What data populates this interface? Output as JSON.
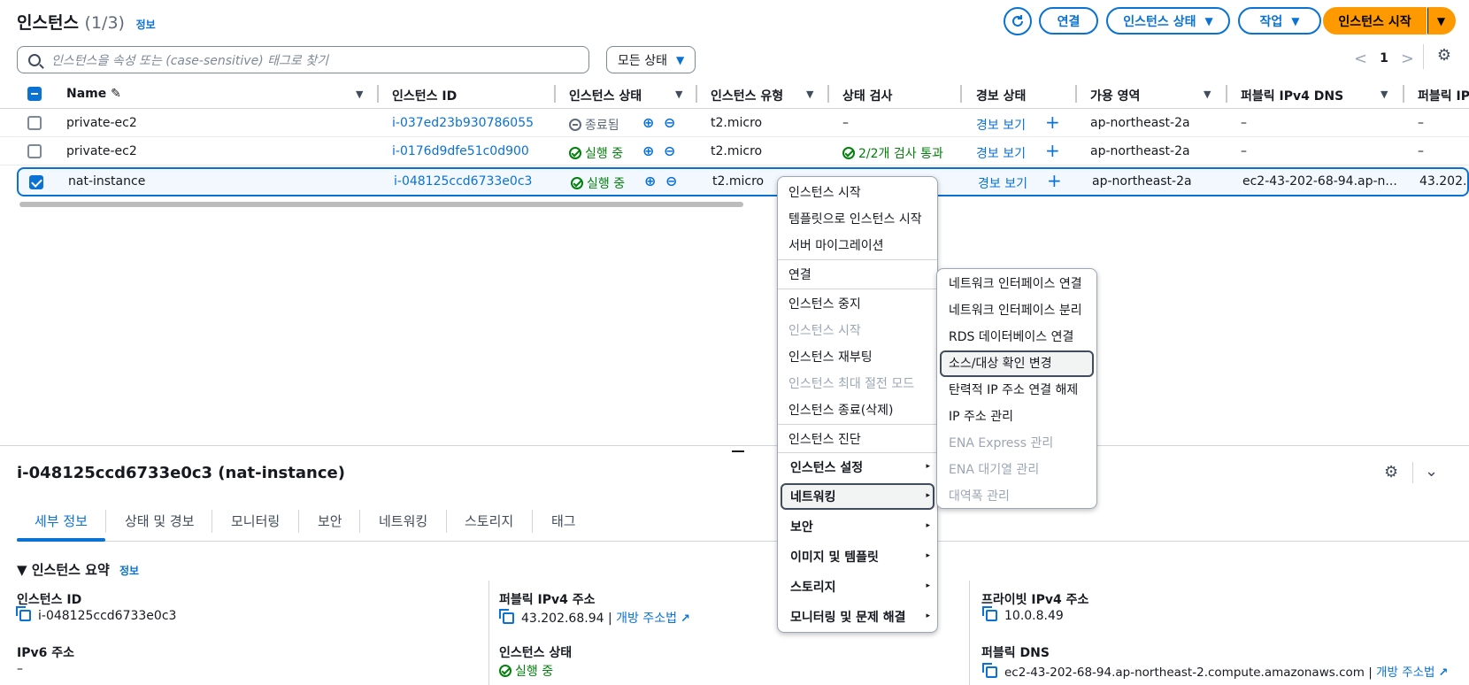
{
  "header": {
    "title": "인스턴스",
    "count": "(1/3)",
    "info": "정보",
    "refresh_icon": "refresh-icon",
    "connect": "연결",
    "instance_state": "인스턴스 상태",
    "actions": "작업",
    "launch": "인스턴스 시작"
  },
  "search": {
    "placeholder": "인스턴스을 속성 또는 (case-sensitive) 태그로 찾기",
    "status_filter": "모든 상태"
  },
  "pager": {
    "page": "1",
    "prev": "<",
    "next": ">"
  },
  "table": {
    "columns": [
      "Name",
      "인스턴스 ID",
      "인스턴스 상태",
      "인스턴스 유형",
      "상태 검사",
      "경보 상태",
      "가용 영역",
      "퍼블릭 IPv4 DNS",
      "퍼블릭 IP"
    ],
    "rows": [
      {
        "name": "private-ec2",
        "id": "i-037ed23b930786055",
        "state": "종료됨",
        "type": "t2.micro",
        "check": "–",
        "alarm": "경보 보기",
        "az": "ap-northeast-2a",
        "dns": "–",
        "ip": "–",
        "selected": false
      },
      {
        "name": "private-ec2",
        "id": "i-0176d9dfe51c0d900",
        "state": "실행 중",
        "type": "t2.micro",
        "check": "2/2개 검사 통과",
        "alarm": "경보 보기",
        "az": "ap-northeast-2a",
        "dns": "–",
        "ip": "–",
        "selected": false
      },
      {
        "name": "nat-instance",
        "id": "i-048125ccd6733e0c3",
        "state": "실행 중",
        "type": "t2.micro",
        "check": "",
        "alarm": "경보 보기",
        "az": "ap-northeast-2a",
        "dns": "ec2-43-202-68-94.ap-n...",
        "ip": "43.202.",
        "selected": true
      }
    ]
  },
  "context_menu": {
    "items": [
      "인스턴스 시작",
      "템플릿으로 인스턴스 시작",
      "서버 마이그레이션",
      "연결",
      "인스턴스 중지",
      "인스턴스 시작",
      "인스턴스 재부팅",
      "인스턴스 최대 절전 모드",
      "인스턴스 종료(삭제)",
      "인스턴스 진단"
    ],
    "submenus": [
      "인스턴스 설정",
      "네트워킹",
      "보안",
      "이미지 및 템플릿",
      "스토리지",
      "모니터링 및 문제 해결"
    ],
    "arrow": "▸"
  },
  "networking_submenu": {
    "items": [
      "네트워크 인터페이스 연결",
      "네트워크 인터페이스 분리",
      "RDS 데이터베이스 연결",
      "소스/대상 확인 변경",
      "탄력적 IP 주소 연결 해제",
      "IP 주소 관리",
      "ENA Express 관리",
      "ENA 대기열 관리",
      "대역폭 관리"
    ]
  },
  "detail": {
    "title": "i-048125ccd6733e0c3 (nat-instance)",
    "tabs": [
      "세부 정보",
      "상태 및 경보",
      "모니터링",
      "보안",
      "네트워킹",
      "스토리지",
      "태그"
    ],
    "summary_title": "▼ 인스턴스 요약",
    "summary_info": "정보",
    "fields": {
      "instance_id_label": "인스턴스 ID",
      "instance_id": "i-048125ccd6733e0c3",
      "public_ipv4_label": "퍼블릭 IPv4 주소",
      "public_ipv4": "43.202.68.94",
      "open_address": "개방 주소법",
      "private_ipv4_label": "프라이빗 IPv4 주소",
      "private_ipv4": "10.0.8.49",
      "ipv6_label": "IPv6 주소",
      "ipv6": "–",
      "instance_state_label": "인스턴스 상태",
      "instance_state": "실행 중",
      "public_dns_label": "퍼블릭 DNS",
      "public_dns": "ec2-43-202-68-94.ap-northeast-2.compute.amazonaws.com",
      "separator": "|"
    }
  },
  "colors": {
    "accent": "#0972d3",
    "primary": "#ff9900",
    "success": "#037f0c"
  }
}
